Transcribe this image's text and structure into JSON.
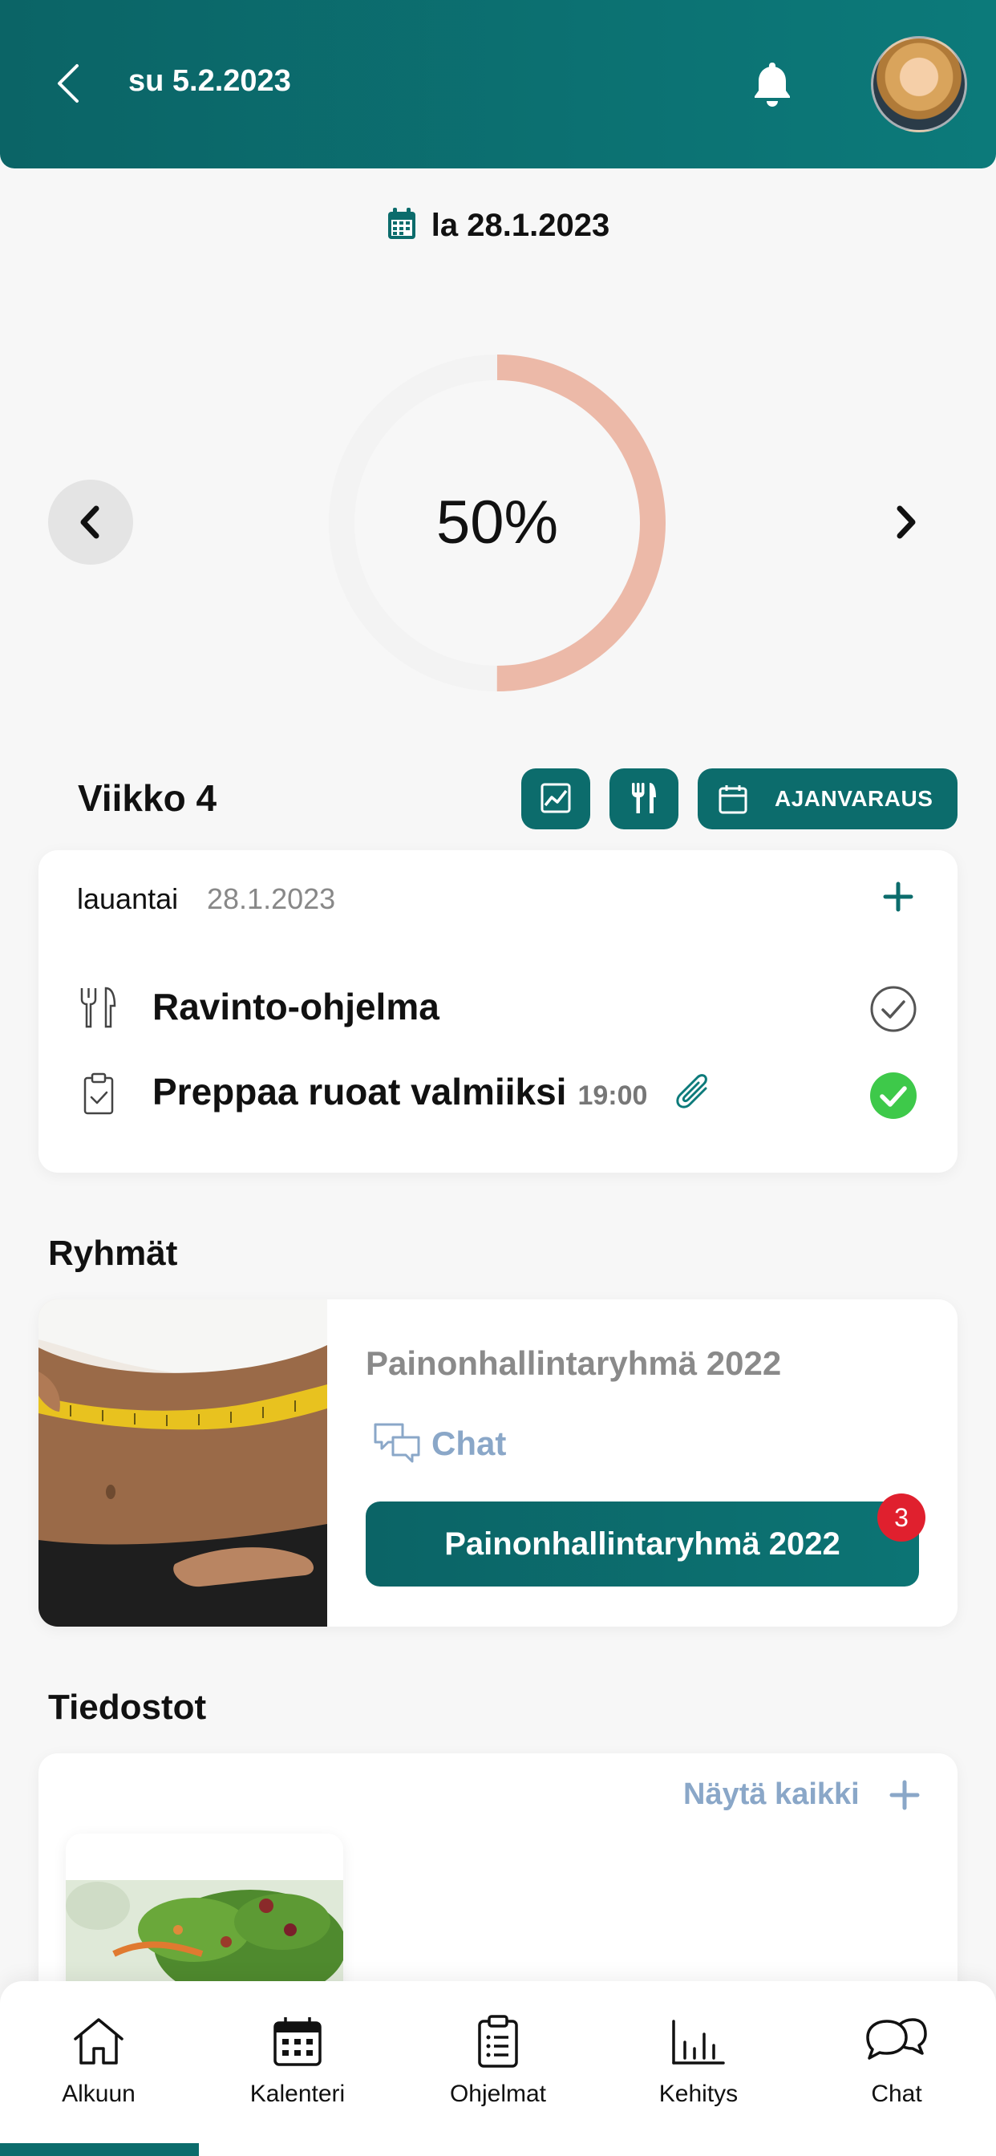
{
  "header": {
    "date": "su 5.2.2023"
  },
  "date_selector": {
    "date": "la 28.1.2023"
  },
  "progress": {
    "percent_label": "50%",
    "value": 0.5,
    "track_color": "#f3f3f3",
    "fill_color": "#ecb9a8"
  },
  "week": {
    "title": "Viikko 4",
    "booking_label": "AJANVARAUS"
  },
  "day": {
    "weekday": "lauantai",
    "date": "28.1.2023",
    "tasks": [
      {
        "title": "Ravinto-ohjelma",
        "time": "",
        "done": false
      },
      {
        "title": "Preppaa ruoat valmiiksi",
        "time": "19:00",
        "done": true
      }
    ]
  },
  "groups": {
    "section_title": "Ryhmät",
    "items": [
      {
        "name": "Painonhallintaryhmä 2022",
        "chat_label": "Chat",
        "button_label": "Painonhallintaryhmä 2022",
        "badge": "3"
      }
    ]
  },
  "files": {
    "section_title": "Tiedostot",
    "show_all_label": "Näytä kaikki"
  },
  "bottom_nav": {
    "items": [
      {
        "label": "Alkuun",
        "icon": "home-icon"
      },
      {
        "label": "Kalenteri",
        "icon": "calendar-icon"
      },
      {
        "label": "Ohjelmat",
        "icon": "clipboard-icon"
      },
      {
        "label": "Kehitys",
        "icon": "bar-chart-icon"
      },
      {
        "label": "Chat",
        "icon": "chat-bubbles-icon"
      }
    ],
    "active_index": 0
  },
  "colors": {
    "primary": "#0c6c6c",
    "accent_link": "#8aa7c8",
    "badge": "#e0202e",
    "done_green": "#3ec94a"
  }
}
